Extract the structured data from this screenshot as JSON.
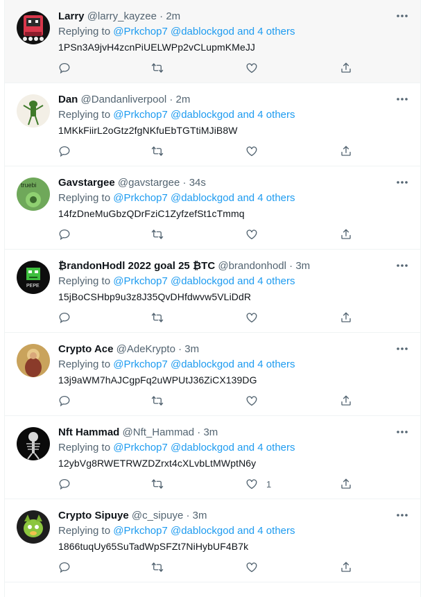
{
  "tweets": [
    {
      "name": "Larry",
      "handle": "@larry_kayzee",
      "dot": "·",
      "time": "2m",
      "reply_prefix": "Replying to",
      "mentions": "@Prkchop7 @dablockgod and 4 others",
      "text": "1PSn3A9jvH4zcnPiUELWPp2vCLupmKMeJJ",
      "likes": "",
      "hover": true,
      "avatar_icon": "pixel-art-avatar"
    },
    {
      "name": "Dan",
      "handle": "@Dandanliverpool",
      "dot": "·",
      "time": "2m",
      "reply_prefix": "Replying to",
      "mentions": "@Prkchop7 @dablockgod and 4 others",
      "text": "1MKkFiirL2oGtz2fgNKfuEbTGTtiMJiB8W",
      "likes": "",
      "avatar_icon": "green-creature-avatar"
    },
    {
      "name": "Gavstargee",
      "handle": "@gavstargee",
      "dot": "·",
      "time": "34s",
      "reply_prefix": "Replying to",
      "mentions": "@Prkchop7 @dablockgod and 4 others",
      "text": "14fzDneMuGbzQDrFziC1ZyfzefSt1cTmmq",
      "likes": "",
      "avatar_icon": "truebit-avatar",
      "avatar_text": "truebi"
    },
    {
      "name": "₿randonHodl 2022 goal 25 ₿TC",
      "handle": "@brandonhodl",
      "dot": "·",
      "time": "3m",
      "reply_prefix": "Replying to",
      "mentions": "@Prkchop7 @dablockgod and 4 others",
      "text": "15jBoCSHbp9u3z8J35QvDHfdwvw5VLiDdR",
      "likes": "",
      "avatar_icon": "pepe-nft-avatar",
      "avatar_text": "PEPE"
    },
    {
      "name": "Crypto Ace",
      "handle": "@AdeKrypto",
      "dot": "·",
      "time": "3m",
      "reply_prefix": "Replying to",
      "mentions": "@Prkchop7 @dablockgod and 4 others",
      "text": "13j9aWM7hAJCgpFq2uWPUtJ36ZiCX139DG",
      "likes": "",
      "avatar_icon": "painting-avatar"
    },
    {
      "name": "Nft Hammad",
      "handle": "@Nft_Hammad",
      "dot": "·",
      "time": "3m",
      "reply_prefix": "Replying to",
      "mentions": "@Prkchop7 @dablockgod and 4 others",
      "text": "12ybVg8RWETRWZDZrxt4cXLvbLtMWptN6y",
      "likes": "1",
      "avatar_icon": "skeleton-avatar"
    },
    {
      "name": "Crypto Sipuye",
      "handle": "@c_sipuye",
      "dot": "·",
      "time": "3m",
      "reply_prefix": "Replying to",
      "mentions": "@Prkchop7 @dablockgod and 4 others",
      "text": "1866tuqUy65SuTadWpSFZt7NiHybUF4B7k",
      "likes": "",
      "avatar_icon": "green-dog-avatar"
    }
  ],
  "colors": {
    "accent": "#1d9bf0",
    "secondary": "#536471",
    "text": "#0f1419",
    "divider": "#eff3f4",
    "hover": "#f7f7f7"
  },
  "icons": {
    "reply": "reply-icon",
    "retweet": "retweet-icon",
    "like": "heart-icon",
    "share": "share-icon",
    "more": "more-icon"
  }
}
